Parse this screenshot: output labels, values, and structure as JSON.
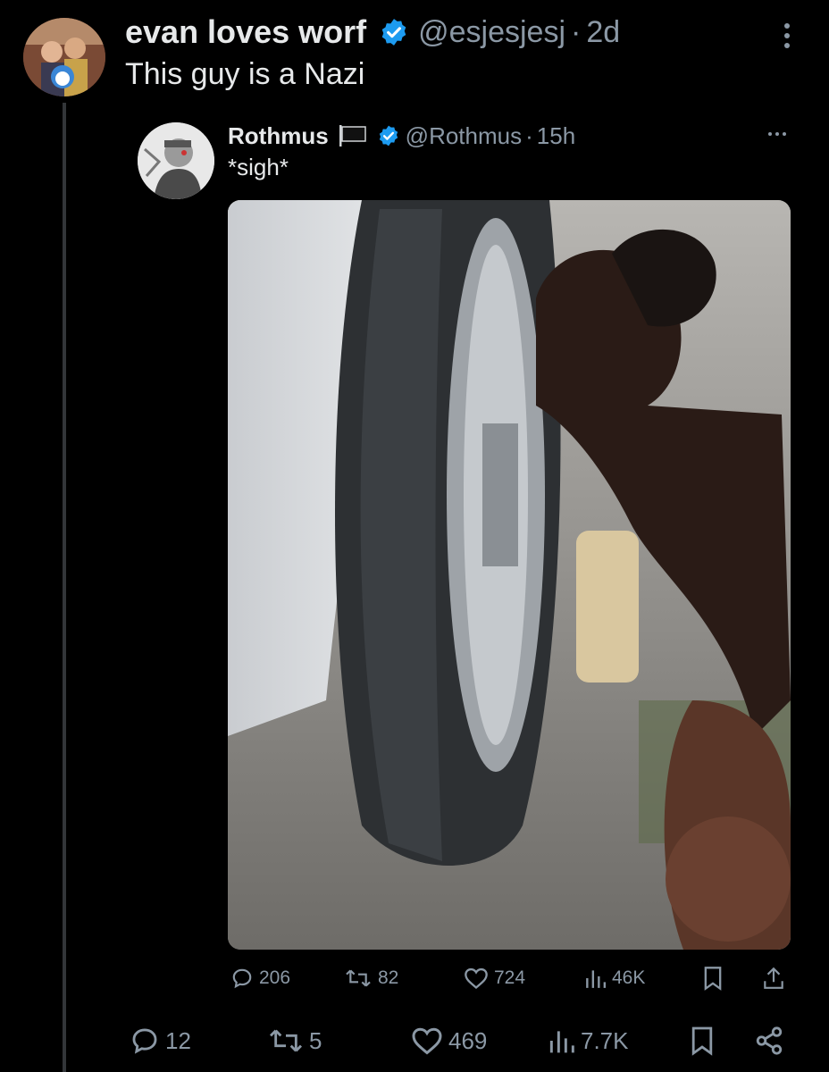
{
  "tweet": {
    "author_name": "evan loves worf",
    "handle": "@esjesjesj",
    "time": "2d",
    "separator": "·",
    "text": "This guy is a Nazi",
    "stats": {
      "replies": "12",
      "reposts": "5",
      "likes": "469",
      "views": "7.7K"
    }
  },
  "quote": {
    "author_name": "Rothmus",
    "handle": "@Rothmus",
    "time": "15h",
    "separator": "·",
    "text": "*sigh*",
    "stats": {
      "replies": "206",
      "reposts": "82",
      "likes": "724",
      "views": "46K"
    }
  },
  "icons": [
    "verified-badge-icon",
    "flag-icon",
    "more-icon",
    "reply-icon",
    "repost-icon",
    "like-icon",
    "views-icon",
    "bookmark-icon",
    "share-icon"
  ],
  "colors": {
    "background": "#000000",
    "text": "#e7e9ea",
    "muted": "#8b98a5",
    "verified": "#1d9bf0",
    "thread_line": "#333639"
  }
}
